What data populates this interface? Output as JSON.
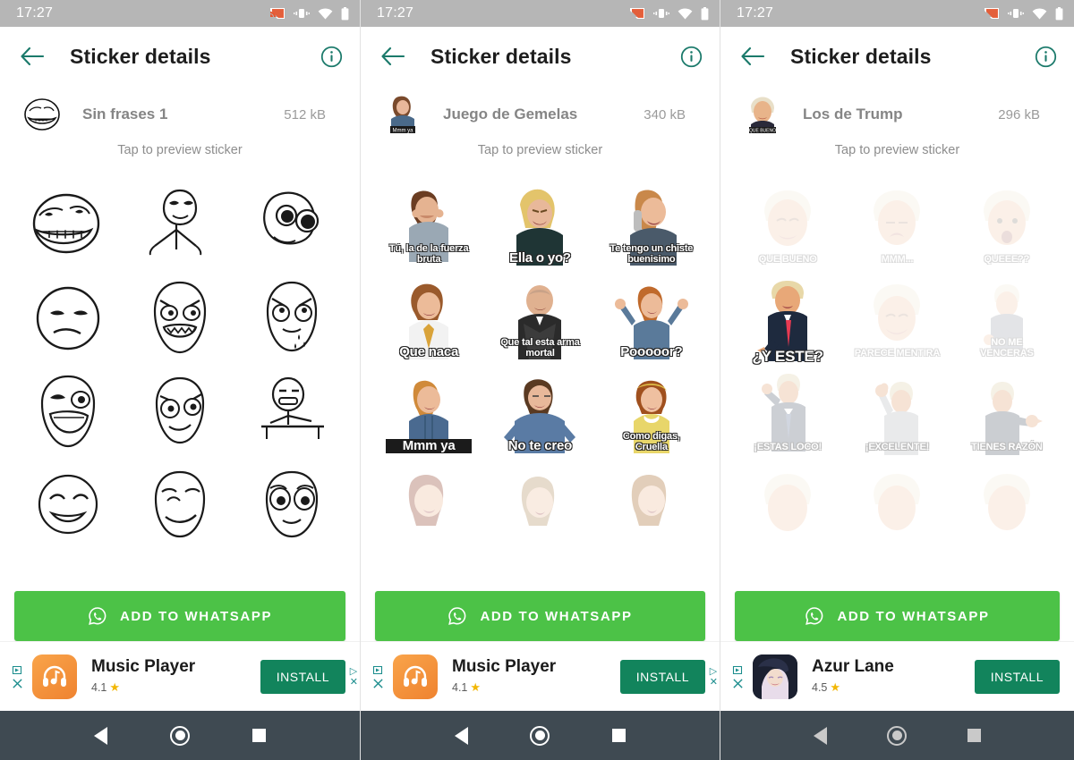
{
  "status_bar": {
    "time": "17:27",
    "icons": [
      "cast-icon",
      "vibrate-icon",
      "wifi-icon",
      "battery-icon"
    ]
  },
  "app_bar": {
    "title": "Sticker details",
    "back_icon": "back-arrow-icon",
    "info_icon": "info-icon"
  },
  "colors": {
    "accent_teal": "#1b7a6b",
    "whatsapp_green": "#4cc247",
    "install_green": "#12845c",
    "status_bar_gray": "#b6b6b6",
    "nav_bar": "#3f4a52",
    "ad_teal": "#1b8d8d",
    "star_yellow": "#f2b705"
  },
  "common": {
    "preview_hint": "Tap to preview sticker",
    "add_button_label": "ADD TO WHATSAPP",
    "whatsapp_icon": "whatsapp-icon",
    "install_label": "INSTALL",
    "adchoices_icon": "adchoices-icon",
    "close_ad_icon": "close-icon"
  },
  "nav_bar": {
    "back": "nav-back-icon",
    "home": "nav-home-icon",
    "recents": "nav-recents-icon"
  },
  "panels": [
    {
      "id": "panel-sin-frases",
      "pack_name": "Sin frases 1",
      "pack_size": "512 kB",
      "thumb": "trollface-thumb",
      "stickers": [
        {
          "art": "trollface",
          "caption": ""
        },
        {
          "art": "determined",
          "caption": ""
        },
        {
          "art": "crazy-eyes",
          "caption": ""
        },
        {
          "art": "annoyed",
          "caption": ""
        },
        {
          "art": "rage",
          "caption": ""
        },
        {
          "art": "cry",
          "caption": ""
        },
        {
          "art": "lol",
          "caption": ""
        },
        {
          "art": "puzzled",
          "caption": ""
        },
        {
          "art": "table-flip",
          "caption": ""
        },
        {
          "art": "happy-closed",
          "caption": ""
        },
        {
          "art": "forever-alone",
          "caption": ""
        },
        {
          "art": "sad-puppy",
          "caption": ""
        }
      ],
      "ad": {
        "title": "Music Player",
        "rating": "4.1",
        "icon": "music-player-icon"
      }
    },
    {
      "id": "panel-juego-de-gemelas",
      "pack_name": "Juego de Gemelas",
      "pack_size": "340 kB",
      "thumb": "gemelas-thumb",
      "thumb_caption": "Mmm ya",
      "stickers": [
        {
          "art": "girl-shout",
          "caption": "Tú, la de la fuerza bruta"
        },
        {
          "art": "blonde-angry",
          "caption": "Ella o yo?"
        },
        {
          "art": "girl-phone",
          "caption": "Te tengo un chiste buenisimo"
        },
        {
          "art": "girl-tie",
          "caption": "Que naca"
        },
        {
          "art": "bald-man",
          "caption": "Que tal esta arma mortal"
        },
        {
          "art": "girl-hands-up",
          "caption": "Pooooor?"
        },
        {
          "art": "girl-denim",
          "caption": "Mmm ya"
        },
        {
          "art": "woman-denim",
          "caption": "No te creo"
        },
        {
          "art": "girl-yellow",
          "caption": "Como digas, Cruella"
        },
        {
          "art": "girl-face-1",
          "caption": ""
        },
        {
          "art": "girl-face-2",
          "caption": ""
        },
        {
          "art": "girl-face-3",
          "caption": ""
        }
      ],
      "ad": {
        "title": "Music Player",
        "rating": "4.1",
        "icon": "music-player-icon"
      }
    },
    {
      "id": "panel-los-de-trump",
      "pack_name": "Los de Trump",
      "pack_size": "296 kB",
      "thumb": "trump-thumb",
      "thumb_caption": "QUE BUENO",
      "stickers": [
        {
          "art": "trump-smile",
          "caption": "QUE BUENO"
        },
        {
          "art": "trump-pout",
          "caption": "MMM..."
        },
        {
          "art": "trump-surprise",
          "caption": "QUEEE??"
        },
        {
          "art": "trump-point",
          "caption": "¿Y ESTE?"
        },
        {
          "art": "trump-grin",
          "caption": "PARECE MENTIRA"
        },
        {
          "art": "trump-point-2",
          "caption": "NO ME VENCERAS"
        },
        {
          "art": "trump-crazy",
          "caption": "¡ESTAS LOCO!"
        },
        {
          "art": "trump-thumbsup",
          "caption": "¡EXCELENTE!"
        },
        {
          "art": "trump-right",
          "caption": "TIENES RAZÓN"
        },
        {
          "art": "trump-face-1",
          "caption": ""
        },
        {
          "art": "trump-face-2",
          "caption": ""
        },
        {
          "art": "trump-face-3",
          "caption": ""
        }
      ],
      "ad": {
        "title": "Azur Lane",
        "rating": "4.5",
        "icon": "azur-lane-icon"
      }
    }
  ]
}
